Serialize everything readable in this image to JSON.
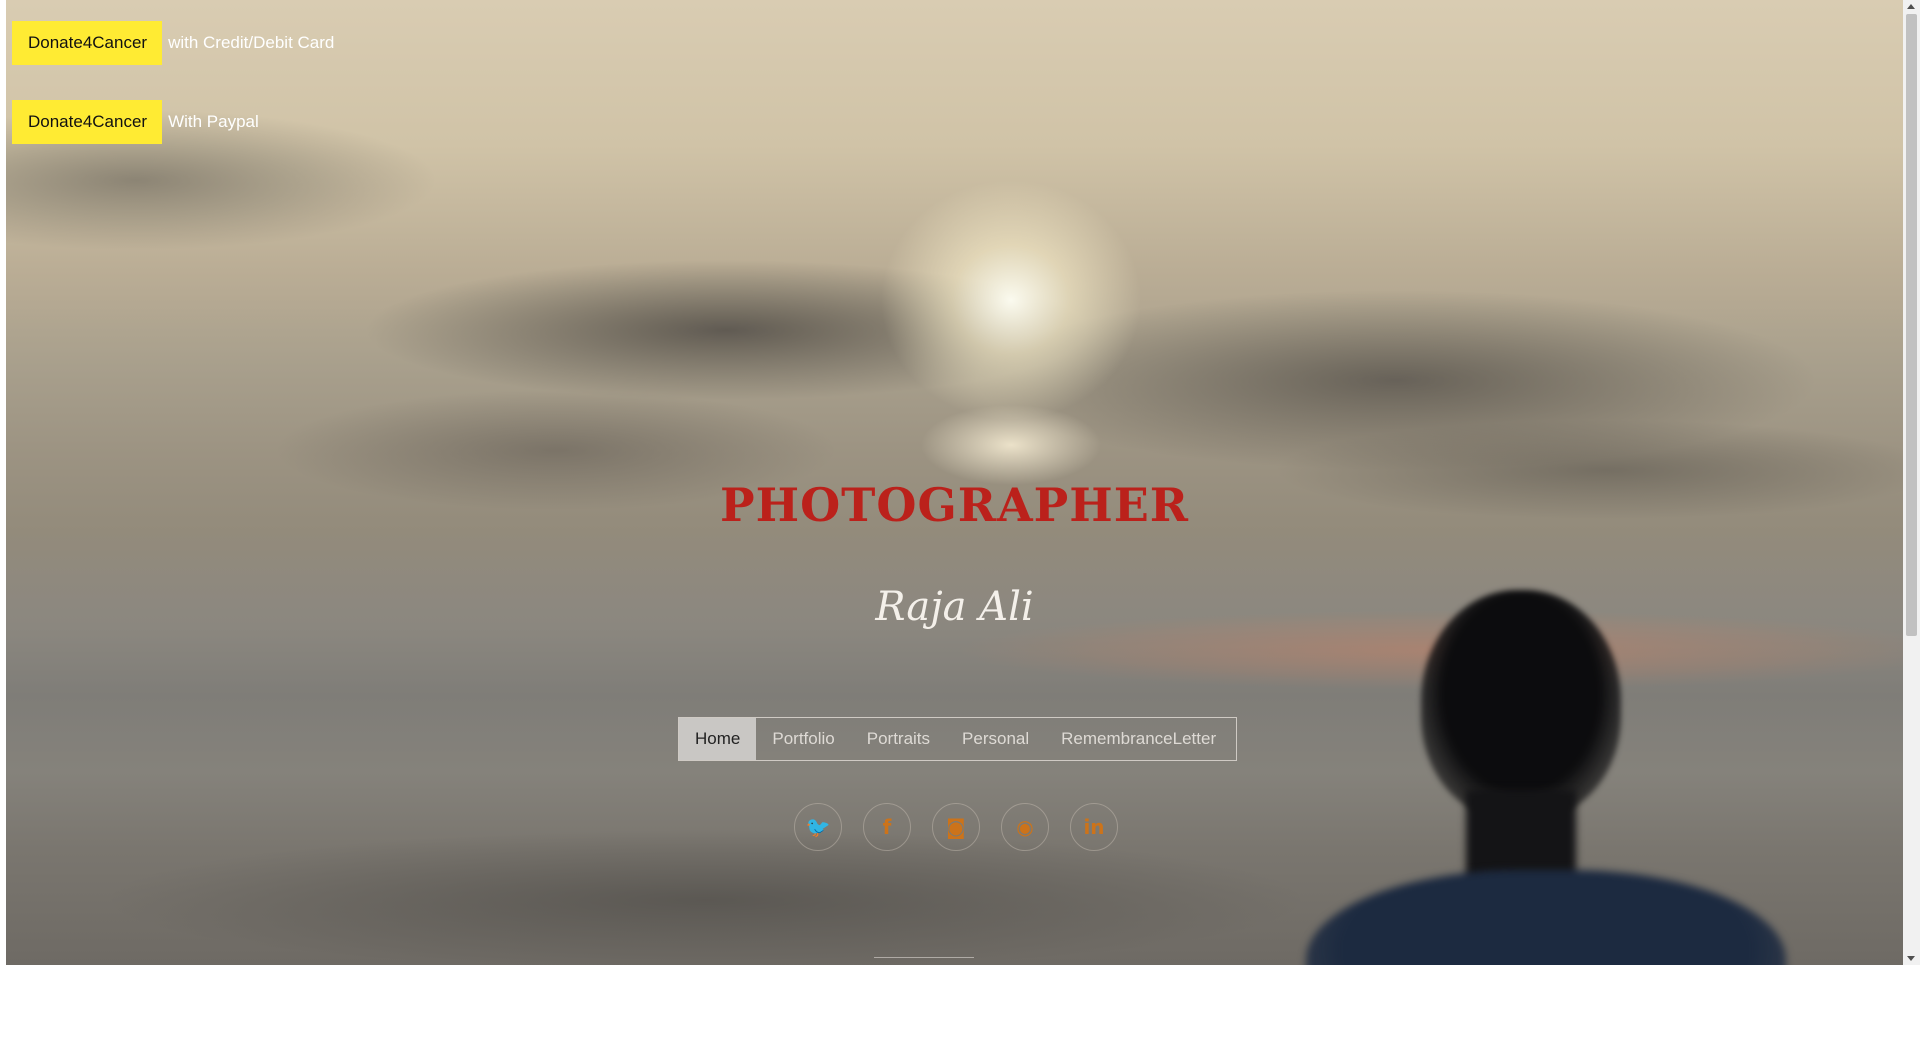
{
  "donations": [
    {
      "button_label": "Donate4Cancer",
      "text": "with Credit/Debit Card"
    },
    {
      "button_label": "Donate4Cancer",
      "text": "With Paypal"
    }
  ],
  "hero": {
    "title": "PHOTOGRAPHER",
    "subtitle": "Raja Ali"
  },
  "nav": {
    "items": [
      {
        "label": "Home",
        "active": true
      },
      {
        "label": "Portfolio",
        "active": false
      },
      {
        "label": "Portraits",
        "active": false
      },
      {
        "label": "Personal",
        "active": false
      },
      {
        "label": "RemembranceLetter",
        "active": false
      }
    ]
  },
  "social": [
    {
      "icon": "twitter-icon",
      "glyph": "🐦"
    },
    {
      "icon": "facebook-icon",
      "glyph": "f"
    },
    {
      "icon": "instagram-icon",
      "glyph": "◙"
    },
    {
      "icon": "github-icon",
      "glyph": "◉"
    },
    {
      "icon": "linkedin-icon",
      "glyph": "in"
    }
  ],
  "colors": {
    "donate_button": "#ffeb3b",
    "title": "#b5231d",
    "social_icon": "#c8741f"
  }
}
